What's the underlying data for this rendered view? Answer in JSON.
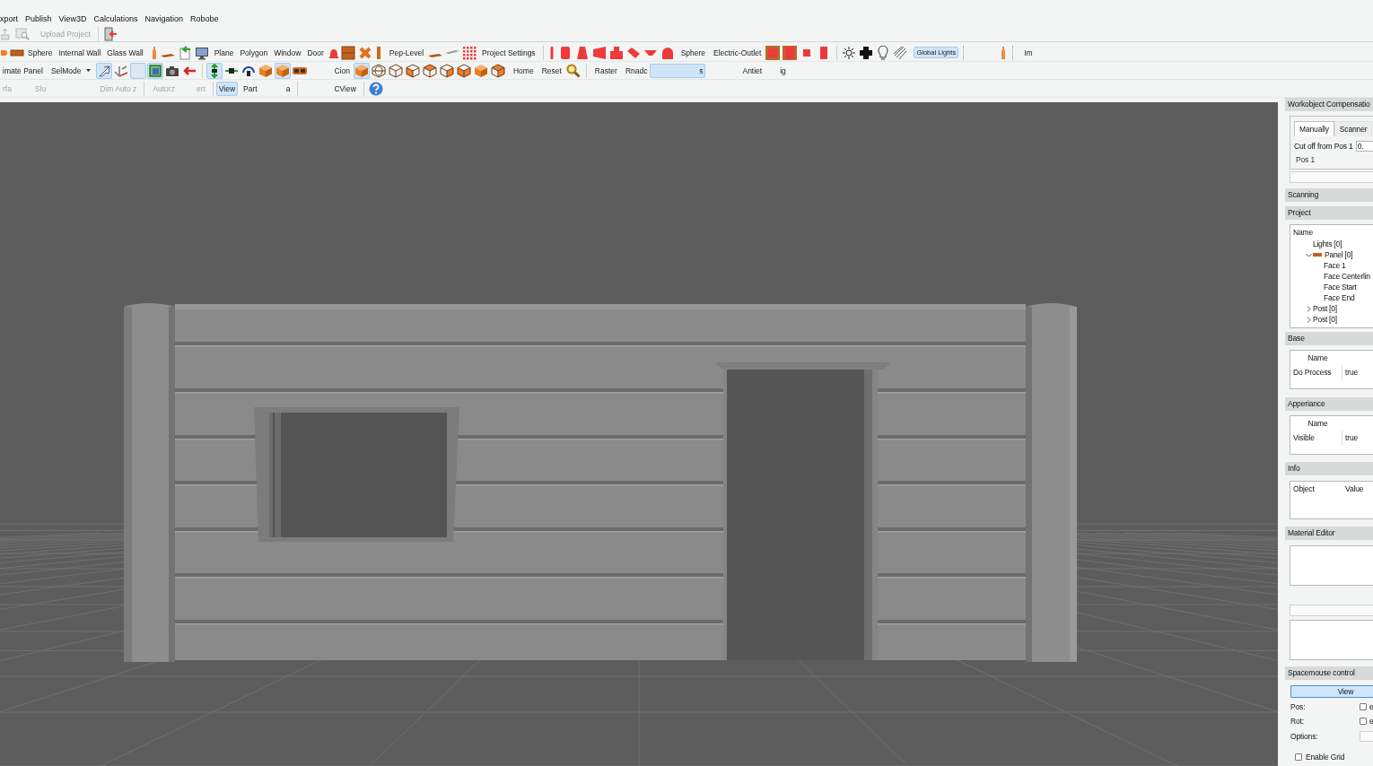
{
  "menu": [
    "xport",
    "Publish",
    "View3D",
    "Calculations",
    "Navigation",
    "Robobe"
  ],
  "quick_bar": {
    "items": [
      {
        "kind": "icon",
        "disabled": true
      },
      {
        "kind": "icon",
        "disabled": true
      },
      {
        "kind": "text",
        "label": "Upload Project",
        "disabled": true
      },
      {
        "kind": "icon",
        "disabled": false
      }
    ]
  },
  "toolbar_1": {
    "items": [
      {
        "kind": "icon",
        "selected": false
      },
      {
        "kind": "icon",
        "selected": false
      },
      {
        "kind": "text",
        "label": "Sphere",
        "selected": false
      },
      {
        "kind": "text",
        "label": "Internal Wall",
        "selected": false
      },
      {
        "kind": "text",
        "label": "Glass Wall",
        "selected": false
      },
      {
        "kind": "icon",
        "selected": false
      },
      {
        "kind": "icon",
        "selected": false
      },
      {
        "kind": "icon",
        "selected": false
      },
      {
        "kind": "icon",
        "selected": false
      },
      {
        "kind": "text",
        "label": "Plane",
        "selected": false
      },
      {
        "kind": "text",
        "label": "Polygon",
        "selected": false
      },
      {
        "kind": "text",
        "label": "Window",
        "selected": false
      },
      {
        "kind": "text",
        "label": "Door",
        "selected": false
      },
      {
        "kind": "icon",
        "selected": false
      },
      {
        "kind": "icon",
        "selected": false
      },
      {
        "kind": "icon",
        "selected": false
      },
      {
        "kind": "icon",
        "selected": false
      },
      {
        "kind": "text",
        "label": "Pep-Level",
        "selected": false
      },
      {
        "kind": "icon",
        "selected": false
      },
      {
        "kind": "icon",
        "selected": false
      },
      {
        "kind": "icon",
        "selected": false
      },
      {
        "kind": "text",
        "label": "Project Settings",
        "selected": false
      },
      {
        "kind": "icon",
        "selected": false
      },
      {
        "kind": "icon",
        "selected": false
      },
      {
        "kind": "icon",
        "selected": false
      },
      {
        "kind": "icon",
        "selected": false
      },
      {
        "kind": "icon",
        "selected": false
      },
      {
        "kind": "icon",
        "selected": false
      },
      {
        "kind": "icon",
        "selected": false
      },
      {
        "kind": "icon",
        "selected": false
      },
      {
        "kind": "text",
        "label": "Sphere",
        "selected": false
      },
      {
        "kind": "text",
        "label": "Electric-Outlet",
        "selected": false
      },
      {
        "kind": "icon",
        "selected": false
      },
      {
        "kind": "icon",
        "selected": false
      },
      {
        "kind": "icon",
        "selected": false
      },
      {
        "kind": "icon",
        "selected": false
      },
      {
        "kind": "icon",
        "selected": false
      },
      {
        "kind": "icon",
        "selected": false
      },
      {
        "kind": "icon",
        "selected": false
      },
      {
        "kind": "icon",
        "selected": false
      },
      {
        "kind": "text",
        "label": "Global Lights",
        "selected": true
      },
      {
        "kind": "icon",
        "selected": false
      },
      {
        "kind": "text",
        "label": "Im",
        "selected": false
      }
    ]
  },
  "toolbar_2": {
    "items": [
      {
        "kind": "text",
        "label": "imate Panel",
        "selected": false
      },
      {
        "kind": "dropdown",
        "label": "SelMode",
        "selected": false
      },
      {
        "kind": "icon",
        "selected": true
      },
      {
        "kind": "icon",
        "selected": false
      },
      {
        "kind": "icon",
        "selected": true
      },
      {
        "kind": "icon",
        "selected": true
      },
      {
        "kind": "icon",
        "selected": false
      },
      {
        "kind": "icon",
        "selected": false
      },
      {
        "kind": "icon",
        "selected": true
      },
      {
        "kind": "icon",
        "selected": false
      },
      {
        "kind": "icon",
        "selected": false
      },
      {
        "kind": "icon",
        "selected": false
      },
      {
        "kind": "icon",
        "selected": true
      },
      {
        "kind": "icon",
        "selected": false
      },
      {
        "kind": "text",
        "label": "Cion",
        "selected": false
      },
      {
        "kind": "icon",
        "selected": true
      },
      {
        "kind": "icon",
        "selected": false
      },
      {
        "kind": "icon",
        "selected": false
      },
      {
        "kind": "icon",
        "selected": false
      },
      {
        "kind": "icon",
        "selected": false
      },
      {
        "kind": "icon",
        "selected": false
      },
      {
        "kind": "icon",
        "selected": false
      },
      {
        "kind": "icon",
        "selected": false
      },
      {
        "kind": "icon",
        "selected": false
      },
      {
        "kind": "text",
        "label": "Home",
        "selected": false
      },
      {
        "kind": "text",
        "label": "Reset",
        "selected": false
      },
      {
        "kind": "icon",
        "selected": false
      },
      {
        "kind": "text",
        "label": "Raster",
        "selected": false
      },
      {
        "kind": "text",
        "label": "Rnadc",
        "selected": false
      },
      {
        "kind": "text",
        "label": "s",
        "selected": true
      },
      {
        "kind": "text",
        "label": "Antiet",
        "selected": false
      },
      {
        "kind": "text",
        "label": "ig",
        "selected": false
      }
    ]
  },
  "toolbar_3": {
    "items": [
      {
        "kind": "text",
        "label": "rfa",
        "selected": false,
        "disabled": true
      },
      {
        "kind": "text",
        "label": "Slu",
        "selected": false,
        "disabled": true
      },
      {
        "kind": "text",
        "label": "Dim Auto z",
        "selected": false,
        "disabled": true
      },
      {
        "kind": "text",
        "label": "Autorz",
        "selected": false,
        "disabled": true
      },
      {
        "kind": "text",
        "label": "ert",
        "selected": false,
        "disabled": true
      },
      {
        "kind": "text",
        "label": "View",
        "selected": true,
        "disabled": false
      },
      {
        "kind": "text",
        "label": "Part",
        "selected": false,
        "disabled": false
      },
      {
        "kind": "text",
        "label": "a",
        "selected": false,
        "disabled": false
      },
      {
        "kind": "text",
        "label": "CView",
        "selected": false,
        "disabled": false
      },
      {
        "kind": "icon",
        "selected": false,
        "disabled": false
      }
    ]
  },
  "right_panel": {
    "workobject": {
      "title": "Workobject Compensatio",
      "tabs": [
        {
          "label": "Manually",
          "selected": true
        },
        {
          "label": "Scanner",
          "selected": false
        }
      ],
      "cut_off": {
        "label": "Cut off from Pos 1",
        "value": "0."
      },
      "group_label": "Pos 1"
    },
    "scanning": {
      "title": "Scanning"
    },
    "project": {
      "title": "Project",
      "column": "Name",
      "tree": [
        {
          "label": "Lights [0]",
          "kind": "item"
        },
        {
          "label": "Panel [0]",
          "kind": "panel",
          "expanded": true,
          "children": [
            {
              "label": "Face 1",
              "kind": "item"
            },
            {
              "label": "Face Centerlin",
              "kind": "item"
            },
            {
              "label": "Face Start",
              "kind": "item"
            },
            {
              "label": "Face End",
              "kind": "item"
            }
          ]
        },
        {
          "label": "Post [0]",
          "kind": "item",
          "expanded": false
        },
        {
          "label": "Post [0]",
          "kind": "item",
          "expanded": false
        }
      ]
    },
    "base": {
      "title": "Base",
      "columns": [
        "Name"
      ],
      "rows": [
        [
          "Do Process",
          "true"
        ]
      ]
    },
    "appearance": {
      "title": "Apperiance",
      "columns": [
        "Name"
      ],
      "rows": [
        [
          "Visible",
          "true"
        ]
      ]
    },
    "info": {
      "title": "Info",
      "columns": [
        "Object",
        "Value"
      ]
    },
    "material_editor": {
      "title": "Material Editor"
    },
    "spacemouse": {
      "title": "Spacemouse control",
      "view_button": {
        "label": "View",
        "selected": true
      },
      "rows": [
        {
          "label": "Pos:",
          "checked": false,
          "option": "e"
        },
        {
          "label": "Rot:",
          "checked": false,
          "option": "e"
        }
      ],
      "options_label": "Options:",
      "enable_grid": {
        "label": "Enable Grid",
        "checked": false
      }
    }
  }
}
